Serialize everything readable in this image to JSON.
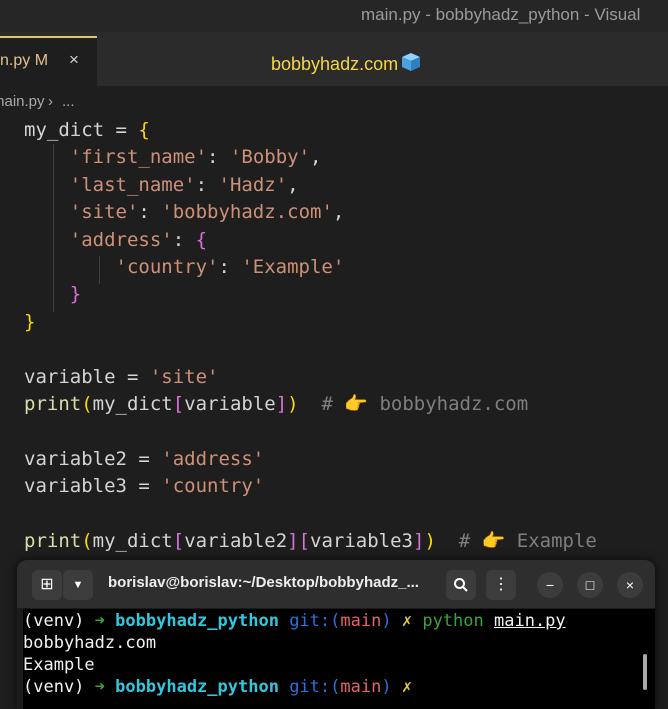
{
  "window": {
    "title": "main.py - bobbyhadz_python - Visual"
  },
  "tab": {
    "name": "n.py",
    "modified": "M",
    "close": "×"
  },
  "header": {
    "brand": "bobbyhadz.com",
    "brand_icon": "ice-cube-icon"
  },
  "breadcrumb": {
    "file": "main.py",
    "sep": "›",
    "more": "..."
  },
  "code_lines": [
    [
      [
        "my_dict ",
        "op"
      ],
      [
        "=",
        "op"
      ],
      [
        " ",
        "op"
      ],
      [
        "{",
        "b1"
      ]
    ],
    [
      [
        "    ",
        "op"
      ],
      [
        "'first_name'",
        "s"
      ],
      [
        ": ",
        "op"
      ],
      [
        "'Bobby'",
        "s"
      ],
      [
        ",",
        "op"
      ]
    ],
    [
      [
        "    ",
        "op"
      ],
      [
        "'last_name'",
        "s"
      ],
      [
        ": ",
        "op"
      ],
      [
        "'Hadz'",
        "s"
      ],
      [
        ",",
        "op"
      ]
    ],
    [
      [
        "    ",
        "op"
      ],
      [
        "'site'",
        "s"
      ],
      [
        ": ",
        "op"
      ],
      [
        "'bobbyhadz.com'",
        "s"
      ],
      [
        ",",
        "op"
      ]
    ],
    [
      [
        "    ",
        "op"
      ],
      [
        "'address'",
        "s"
      ],
      [
        ": ",
        "op"
      ],
      [
        "{",
        "b2"
      ]
    ],
    [
      [
        "        ",
        "op"
      ],
      [
        "'country'",
        "s"
      ],
      [
        ": ",
        "op"
      ],
      [
        "'Example'",
        "s"
      ]
    ],
    [
      [
        "    ",
        "op"
      ],
      [
        "}",
        "b2"
      ]
    ],
    [
      [
        "}",
        "b1"
      ]
    ],
    [],
    [
      [
        "variable ",
        "op"
      ],
      [
        "=",
        "op"
      ],
      [
        " ",
        "op"
      ],
      [
        "'site'",
        "s"
      ]
    ],
    [
      [
        "print",
        "k"
      ],
      [
        "(",
        "b1"
      ],
      [
        "my_dict",
        "op"
      ],
      [
        "[",
        "b2"
      ],
      [
        "variable",
        "op"
      ],
      [
        "]",
        "b2"
      ],
      [
        ")",
        "b1"
      ],
      [
        "  # 👉 bobbyhadz.com",
        "cm"
      ]
    ],
    [],
    [
      [
        "variable2 ",
        "op"
      ],
      [
        "=",
        "op"
      ],
      [
        " ",
        "op"
      ],
      [
        "'address'",
        "s"
      ]
    ],
    [
      [
        "variable3 ",
        "op"
      ],
      [
        "=",
        "op"
      ],
      [
        " ",
        "op"
      ],
      [
        "'country'",
        "s"
      ]
    ],
    [],
    [
      [
        "print",
        "k"
      ],
      [
        "(",
        "b1"
      ],
      [
        "my_dict",
        "op"
      ],
      [
        "[",
        "b2"
      ],
      [
        "variable2",
        "op"
      ],
      [
        "]",
        "b2"
      ],
      [
        "[",
        "b2"
      ],
      [
        "variable3",
        "op"
      ],
      [
        "]",
        "b2"
      ],
      [
        ")",
        "b1"
      ],
      [
        "  # 👉 Example",
        "cm"
      ]
    ]
  ],
  "terminal": {
    "title": "borislav@borislav:~/Desktop/bobbyhadz_...",
    "new_tab_icon": "new-terminal-icon",
    "lines": [
      {
        "venv": "(venv)",
        "arrow": "➜",
        "dir": "bobbyhadz_python",
        "git": "git:(",
        "branch": "main",
        "git_close": ")",
        "x": "✗",
        "cmd": "python",
        "arg": "main.py"
      },
      {
        "text": "bobbyhadz.com"
      },
      {
        "text": "Example"
      },
      {
        "venv": "(venv)",
        "arrow": "➜",
        "dir": "bobbyhadz_python",
        "git": "git:(",
        "branch": "main",
        "git_close": ")",
        "x": "✗"
      }
    ]
  }
}
